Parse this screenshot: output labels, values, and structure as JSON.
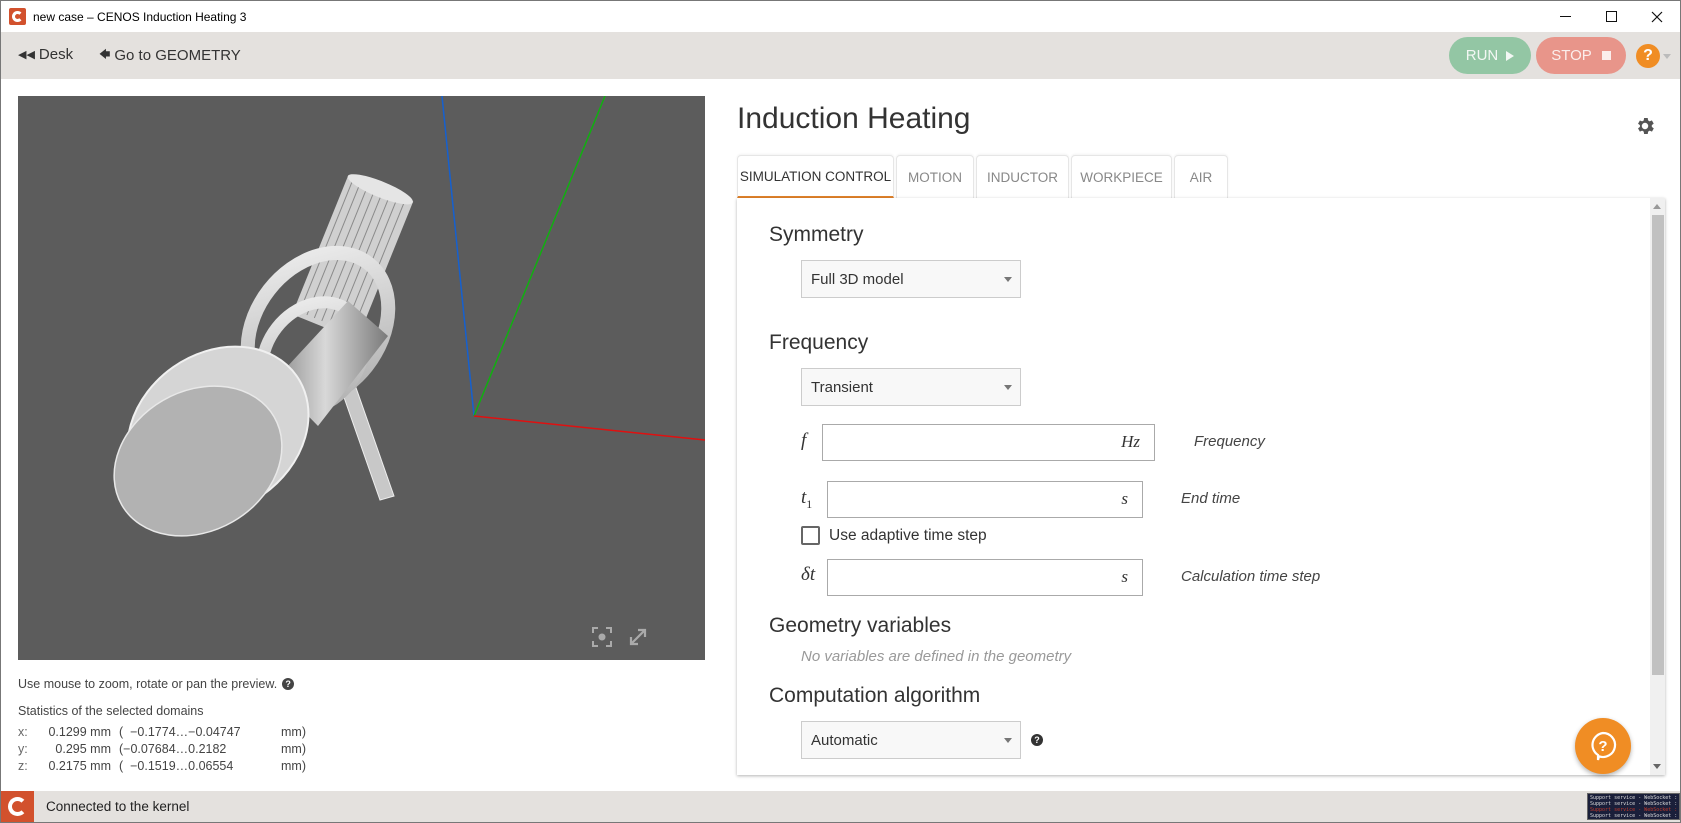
{
  "window": {
    "title": "new case – CENOS Induction Heating 3",
    "controls": [
      "minimize",
      "maximize",
      "close"
    ]
  },
  "toolbar": {
    "desk_label": "Desk",
    "geometry_label": "Go to GEOMETRY",
    "run_label": "RUN",
    "stop_label": "STOP",
    "help_label": "?",
    "colors": {
      "run": "#93c6a4",
      "stop": "#e8958a",
      "help": "#f08d24"
    }
  },
  "viewport": {
    "hint": "Use mouse to zoom, rotate or pan the preview.",
    "axes_colors": {
      "x": "#e01010",
      "y": "#10b010",
      "z": "#1560d0"
    },
    "icons": [
      "focus-icon",
      "expand-icon"
    ]
  },
  "stats": {
    "title": "Statistics of the selected domains",
    "rows": [
      {
        "axis": "x:",
        "value": "0.1299 mm",
        "range": "(  −0.1774…−0.04747",
        "unit": "mm)"
      },
      {
        "axis": "y:",
        "value": "0.295 mm",
        "range": "(−0.07684…0.2182",
        "unit": "mm)"
      },
      {
        "axis": "z:",
        "value": "0.2175 mm",
        "range": "(  −0.1519…0.06554",
        "unit": "mm)"
      }
    ]
  },
  "panel": {
    "title": "Induction Heating",
    "tabs": [
      {
        "label": "SIMULATION CONTROL",
        "active": true
      },
      {
        "label": "MOTION",
        "active": false
      },
      {
        "label": "INDUCTOR",
        "active": false
      },
      {
        "label": "WORKPIECE",
        "active": false
      },
      {
        "label": "AIR",
        "active": false
      }
    ],
    "accent": "#e0822b"
  },
  "form": {
    "symmetry": {
      "title": "Symmetry",
      "value": "Full 3D model"
    },
    "frequency": {
      "title": "Frequency",
      "mode": "Transient",
      "f": {
        "symbol": "f",
        "value": "",
        "unit": "Hz",
        "label": "Frequency"
      },
      "t1": {
        "symbol": "t",
        "sub": "1",
        "value": "",
        "unit": "s",
        "label": "End time"
      },
      "adaptive": {
        "label": "Use adaptive time step",
        "checked": false
      },
      "dt": {
        "symbol": "δt",
        "value": "",
        "unit": "s",
        "label": "Calculation time step"
      }
    },
    "geometry_vars": {
      "title": "Geometry variables",
      "empty": "No variables are defined in the geometry"
    },
    "algorithm": {
      "title": "Computation algorithm",
      "value": "Automatic"
    }
  },
  "status": {
    "text": "Connected to the kernel",
    "log_lines": [
      "Support service - WebSocket :",
      "Support service - WebSocket :",
      "Support service - WebSocket :",
      "Support service - WebSocket :"
    ]
  }
}
